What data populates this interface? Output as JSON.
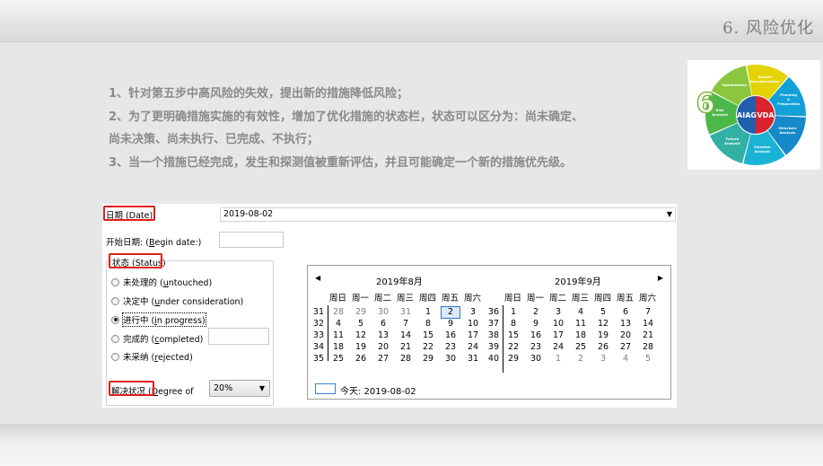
{
  "header": {
    "section_title": "6. 风险优化"
  },
  "intro": {
    "lines": [
      "1、针对第五步中高风险的失效，提出新的措施降低风险；",
      "2、为了更明确措施实施的有效性，增加了优化措施的状态栏，状态可以区分为：尚未确定、",
      "尚未决策、尚未执行、已完成、不执行；",
      "3、当一个措施已经完成，发生和探测值被重新评估，并且可能确定一个新的措施优先级。"
    ]
  },
  "wheel": {
    "center_left": "AIAG",
    "center_right": "VDA",
    "step_number": "6",
    "segments": [
      {
        "label": "Results Documentation",
        "color": "#e3d300"
      },
      {
        "label": "Planning & Preparation",
        "color": "#12a0d8"
      },
      {
        "label": "Structure Analysis",
        "color": "#1689c8"
      },
      {
        "label": "Function Analysis",
        "color": "#1ab3d5"
      },
      {
        "label": "Failure Analysis",
        "color": "#32b0a4"
      },
      {
        "label": "Risk Analysis",
        "color": "#4db84a"
      },
      {
        "label": "Optimization",
        "color": "#8cc63f"
      }
    ]
  },
  "form": {
    "date_label_pre": "日期 (",
    "date_label_u": "D",
    "date_label_post": "ate):",
    "date_value": "2019-08-02",
    "begin_label_pre": "开始日期: (",
    "begin_label_u": "B",
    "begin_label_post": "egin date:)",
    "status_label": "状态 (Status)",
    "status_options": [
      {
        "pre": "未处理的 (",
        "u": "u",
        "post": "ntouched)",
        "selected": false
      },
      {
        "pre": "决定中 (",
        "u": "u",
        "post": "nder consideration)",
        "selected": false
      },
      {
        "pre": "进行中 (",
        "u": "i",
        "post": "n progress)",
        "selected": true
      },
      {
        "pre": "完成的 (",
        "u": "c",
        "post": "ompleted)",
        "selected": false
      },
      {
        "pre": "未采纳 (",
        "u": "r",
        "post": "ejected)",
        "selected": false
      }
    ],
    "degree_label_pre": "解决状况 (",
    "degree_label_u": "D",
    "degree_label_post": "egree of",
    "degree_value": "20%"
  },
  "calendar": {
    "months": [
      {
        "title": "2019年8月",
        "weeks": [
          {
            "no": "31",
            "days": [
              "28",
              "29",
              "30",
              "31",
              "1",
              "2",
              "3"
            ],
            "grey": [
              true,
              true,
              true,
              true,
              false,
              false,
              false
            ]
          },
          {
            "no": "32",
            "days": [
              "4",
              "5",
              "6",
              "7",
              "8",
              "9",
              "10"
            ]
          },
          {
            "no": "33",
            "days": [
              "11",
              "12",
              "13",
              "14",
              "15",
              "16",
              "17"
            ]
          },
          {
            "no": "34",
            "days": [
              "18",
              "19",
              "20",
              "21",
              "22",
              "23",
              "24"
            ]
          },
          {
            "no": "35",
            "days": [
              "25",
              "26",
              "27",
              "28",
              "29",
              "30",
              "31"
            ]
          }
        ]
      },
      {
        "title": "2019年9月",
        "weeks": [
          {
            "no": "36",
            "days": [
              "1",
              "2",
              "3",
              "4",
              "5",
              "6",
              "7"
            ]
          },
          {
            "no": "37",
            "days": [
              "8",
              "9",
              "10",
              "11",
              "12",
              "13",
              "14"
            ]
          },
          {
            "no": "38",
            "days": [
              "15",
              "16",
              "17",
              "18",
              "19",
              "20",
              "21"
            ]
          },
          {
            "no": "39",
            "days": [
              "22",
              "23",
              "24",
              "25",
              "26",
              "27",
              "28"
            ]
          },
          {
            "no": "40",
            "days": [
              "29",
              "30",
              "1",
              "2",
              "3",
              "4",
              "5"
            ],
            "grey": [
              false,
              false,
              true,
              true,
              true,
              true,
              true
            ]
          }
        ]
      }
    ],
    "weekdays": [
      "周日",
      "周一",
      "周二",
      "周三",
      "周四",
      "周五",
      "周六"
    ],
    "selected_day": "2",
    "today_label": "今天: 2019-08-02",
    "prev_icon": "◀",
    "next_icon": "▶"
  }
}
